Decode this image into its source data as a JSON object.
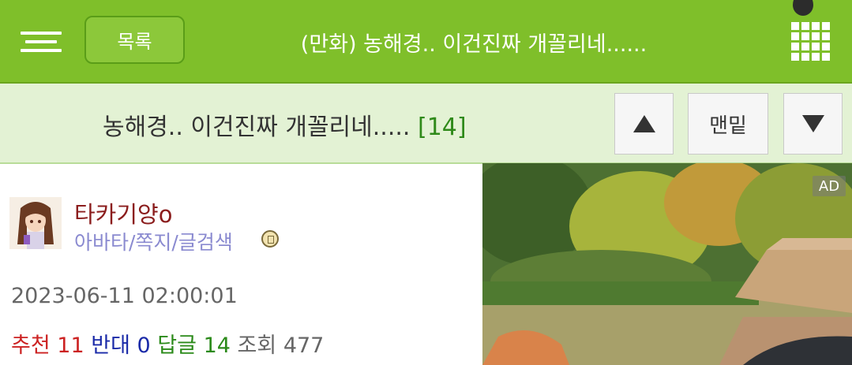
{
  "topbar": {
    "list_label": "목록",
    "title": "(만화) 농해경.. 이건진짜 개꼴리네......",
    "background": "#7fbf2a"
  },
  "subbar": {
    "title": "농해경.. 이건진짜 개꼴리네.....",
    "comment_count": "[14]",
    "bottom_label": "맨밑",
    "background": "#e3f2d4"
  },
  "author": {
    "name": "타카기양o",
    "links": "아바타/쪽지/글검색"
  },
  "post": {
    "date": "2023-06-11 02:00:01",
    "stats": {
      "recommend_label": "추천",
      "recommend": "11",
      "oppose_label": "반대",
      "oppose": "0",
      "reply_label": "답글",
      "reply": "14",
      "view_label": "조회",
      "view": "477"
    }
  },
  "ad": {
    "badge": "AD"
  }
}
